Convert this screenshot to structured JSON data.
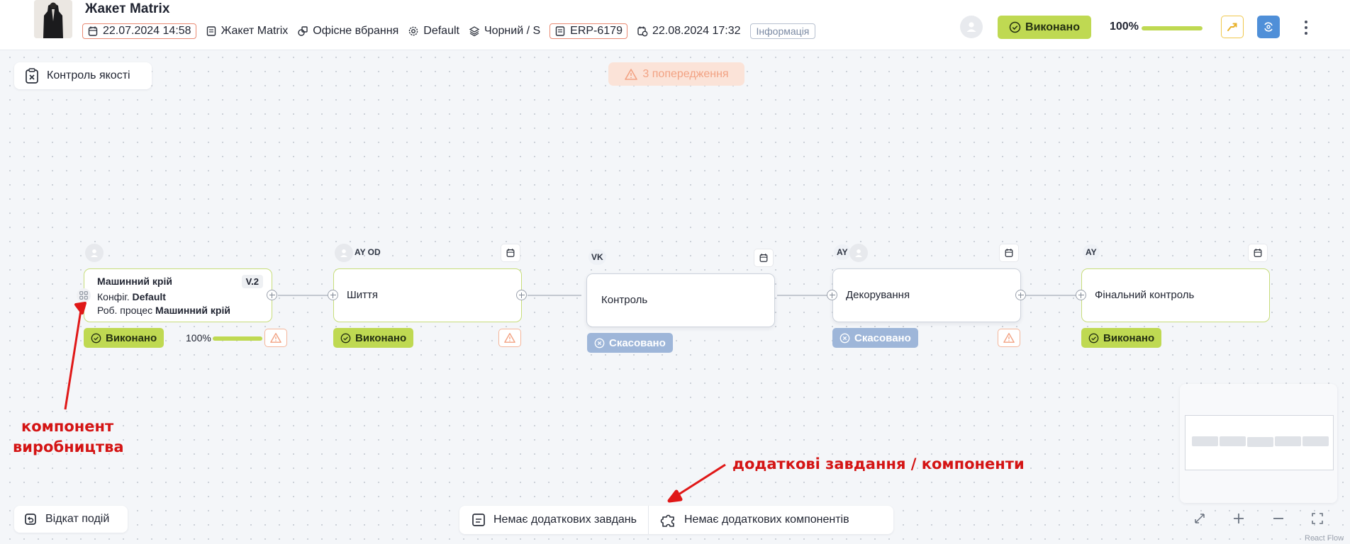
{
  "header": {
    "title": "Жакет Matrix",
    "date_created": "22.07.2024 14:58",
    "product": "Жакет Matrix",
    "category": "Офісне вбрання",
    "config": "Default",
    "variant": "Чорний / S",
    "erp_code": "ERP-6179",
    "deadline": "22.08.2024 17:32",
    "info_tag": "Інформація",
    "status": "Виконано",
    "progress_text": "100%",
    "progress": 1.0
  },
  "canvas": {
    "qc_button": "Контроль якості",
    "warnings": "3 попередження",
    "rollback_button": "Відкат подій",
    "no_tasks": "Немає додаткових завдань",
    "no_components": "Немає додаткових компонентів",
    "react_flow": "React Flow"
  },
  "nodes": [
    {
      "title": "Машинний крій",
      "version": "V.2",
      "config_label": "Конфіг.",
      "config_value": "Default",
      "process_label": "Роб. процес",
      "process_value": "Машинний крій",
      "status": "Виконано",
      "progress_text": "100%",
      "progress": 1.0
    },
    {
      "title": "Шиття",
      "initials": "AY OD",
      "status": "Виконано"
    },
    {
      "title": "Контроль",
      "initials": "VK",
      "status": "Скасовано"
    },
    {
      "title": "Декорування",
      "initials": "AY",
      "status": "Скасовано"
    },
    {
      "title": "Фінальний контроль",
      "initials": "AY",
      "status": "Виконано"
    }
  ],
  "annotations": {
    "component_line1": "компонент",
    "component_line2": "виробництва",
    "extra": "додаткові завдання / компоненти"
  },
  "colors": {
    "done": "#bfd952",
    "cancel": "#9eb6d9",
    "warning": "#f4b59a",
    "accent_blue": "#4f8fd8",
    "annotation": "#d41414"
  }
}
